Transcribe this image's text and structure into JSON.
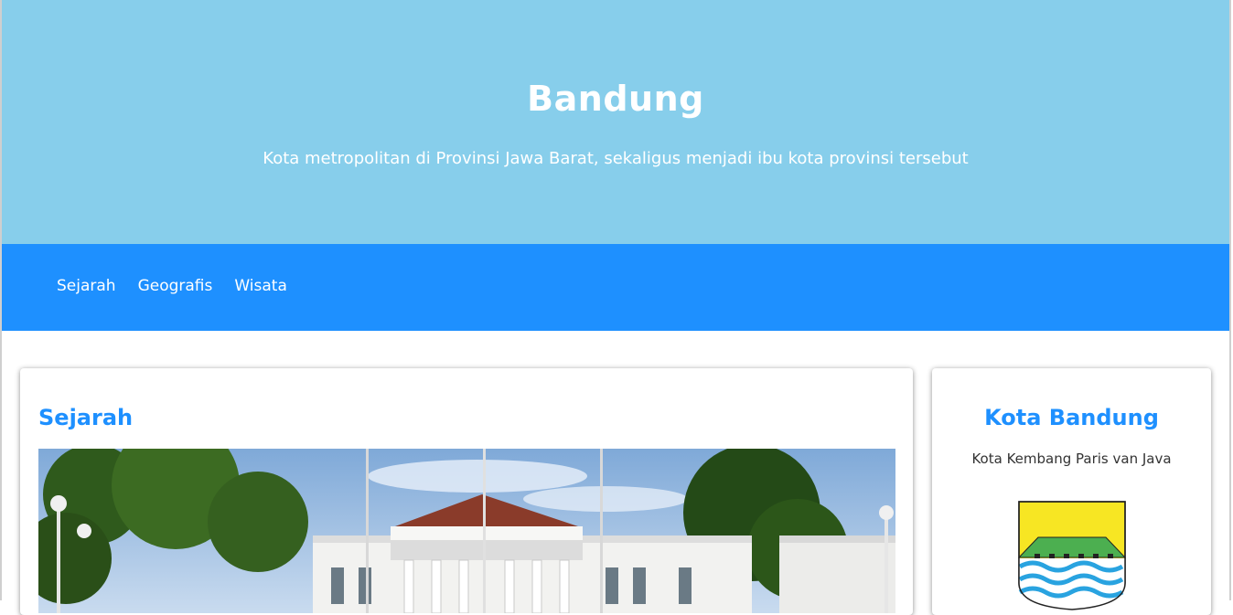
{
  "header": {
    "title": "Bandung",
    "subtitle": "Kota metropolitan di Provinsi Jawa Barat, sekaligus menjadi ibu kota provinsi tersebut"
  },
  "nav": {
    "items": [
      {
        "label": "Sejarah"
      },
      {
        "label": "Geografis"
      },
      {
        "label": "Wisata"
      }
    ]
  },
  "main": {
    "section_title": "Sejarah"
  },
  "sidebar": {
    "title": "Kota Bandung",
    "tagline": "Kota Kembang Paris van Java"
  },
  "colors": {
    "hero_bg": "#87ceeb",
    "nav_bg": "#1e90ff",
    "accent": "#1e90ff"
  },
  "icons": {
    "emblem": "bandung-coat-of-arms-icon",
    "photo": "gedung-sate-building-photo"
  }
}
